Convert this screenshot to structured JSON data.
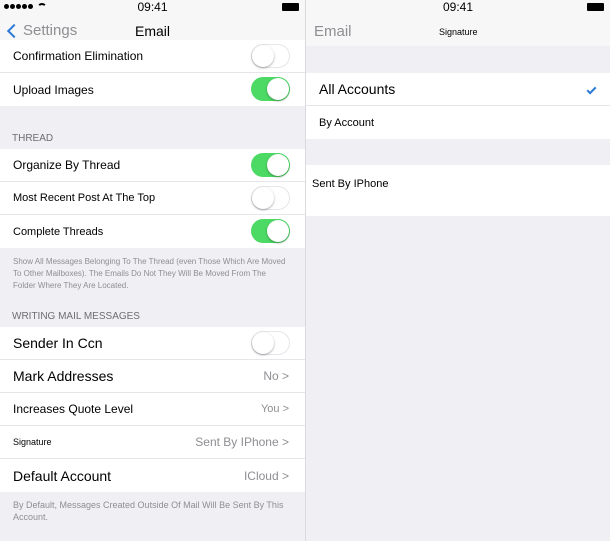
{
  "status_bar": {
    "time": "09:41"
  },
  "left": {
    "nav": {
      "back_label": "Settings",
      "title": "Email"
    },
    "group_top": [
      {
        "label": "Confirmation Elimination",
        "toggle": false
      },
      {
        "label": "Upload Images",
        "toggle": true
      }
    ],
    "thread": {
      "header": "THREAD",
      "rows": [
        {
          "label": "Organize By Thread",
          "toggle": true
        },
        {
          "label": "Most Recent Post At The Top",
          "toggle": false
        },
        {
          "label": "Complete Threads",
          "toggle": true
        }
      ],
      "footer": "Show All Messages Belonging To The Thread (even Those Which Are Moved To Other Mailboxes). The Emails Do Not They Will Be Moved From The Folder Where They Are Located."
    },
    "writing": {
      "header": "WRITING MAIL MESSAGES",
      "sender_in_ccn": {
        "label": "Sender In Ccn",
        "toggle": false
      },
      "mark_addresses": {
        "label": "Mark Addresses",
        "value": "No"
      },
      "increases_quote": {
        "label": "Increases Quote Level",
        "value": "You"
      },
      "signature": {
        "label": "Signature",
        "value": "Sent By IPhone"
      },
      "default_account": {
        "label": "Default Account",
        "value": "ICloud"
      },
      "footer": "By Default, Messages Created Outside Of Mail Will Be Sent By This Account."
    }
  },
  "right": {
    "nav": {
      "back_label": "Email",
      "title": "Signature"
    },
    "options": [
      {
        "label": "All Accounts",
        "selected": true
      },
      {
        "label": "By Account",
        "selected": false
      }
    ],
    "signature_text": "Sent By IPhone"
  },
  "colors": {
    "accent": "#2d7ad6",
    "toggle_on": "#4cd964",
    "background": "#efeff4"
  }
}
